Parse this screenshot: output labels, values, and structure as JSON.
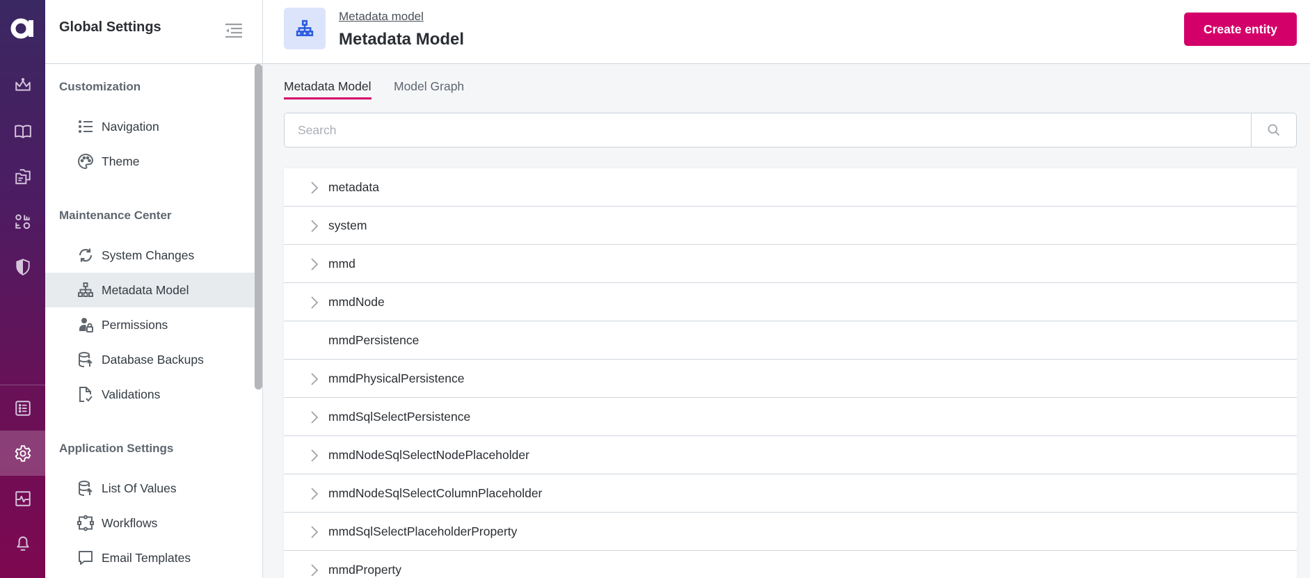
{
  "rail": {
    "logo": "a",
    "items": [
      {
        "icon": "crown-icon"
      },
      {
        "icon": "book-icon"
      },
      {
        "icon": "documents-icon"
      },
      {
        "icon": "shapes-list-icon"
      },
      {
        "icon": "shield-icon"
      },
      {
        "icon": "list-box-icon"
      },
      {
        "icon": "gear-icon",
        "active": true
      },
      {
        "icon": "activity-monitor-icon"
      },
      {
        "icon": "bell-icon"
      }
    ]
  },
  "panel": {
    "title": "Global Settings",
    "sections": [
      {
        "label": "Customization",
        "items": [
          {
            "label": "Navigation",
            "icon": "list-icon"
          },
          {
            "label": "Theme",
            "icon": "palette-icon"
          }
        ]
      },
      {
        "label": "Maintenance Center",
        "items": [
          {
            "label": "System Changes",
            "icon": "sync-icon"
          },
          {
            "label": "Metadata Model",
            "icon": "sitemap-icon",
            "selected": true
          },
          {
            "label": "Permissions",
            "icon": "user-lock-icon"
          },
          {
            "label": "Database Backups",
            "icon": "database-upload-icon"
          },
          {
            "label": "Validations",
            "icon": "file-check-icon"
          }
        ]
      },
      {
        "label": "Application Settings",
        "items": [
          {
            "label": "List Of Values",
            "icon": "database-upload-icon"
          },
          {
            "label": "Workflows",
            "icon": "workflow-icon"
          },
          {
            "label": "Email Templates",
            "icon": "message-icon"
          }
        ]
      }
    ]
  },
  "header": {
    "breadcrumb": "Metadata model",
    "title": "Metadata Model",
    "create_button": "Create entity"
  },
  "tabs": [
    {
      "label": "Metadata Model",
      "active": true
    },
    {
      "label": "Model Graph",
      "active": false
    }
  ],
  "search": {
    "placeholder": "Search",
    "value": ""
  },
  "entities": [
    {
      "name": "metadata",
      "expandable": true
    },
    {
      "name": "system",
      "expandable": true
    },
    {
      "name": "mmd",
      "expandable": true
    },
    {
      "name": "mmdNode",
      "expandable": true
    },
    {
      "name": "mmdPersistence",
      "expandable": false
    },
    {
      "name": "mmdPhysicalPersistence",
      "expandable": true
    },
    {
      "name": "mmdSqlSelectPersistence",
      "expandable": true
    },
    {
      "name": "mmdNodeSqlSelectNodePlaceholder",
      "expandable": true
    },
    {
      "name": "mmdNodeSqlSelectColumnPlaceholder",
      "expandable": true
    },
    {
      "name": "mmdSqlSelectPlaceholderProperty",
      "expandable": true
    },
    {
      "name": "mmdProperty",
      "expandable": true
    }
  ],
  "colors": {
    "accent": "#d4006a",
    "icon_blue": "#2d5bdc",
    "icon_bg": "#dce4fb",
    "selected_bg": "#e7ebee"
  }
}
